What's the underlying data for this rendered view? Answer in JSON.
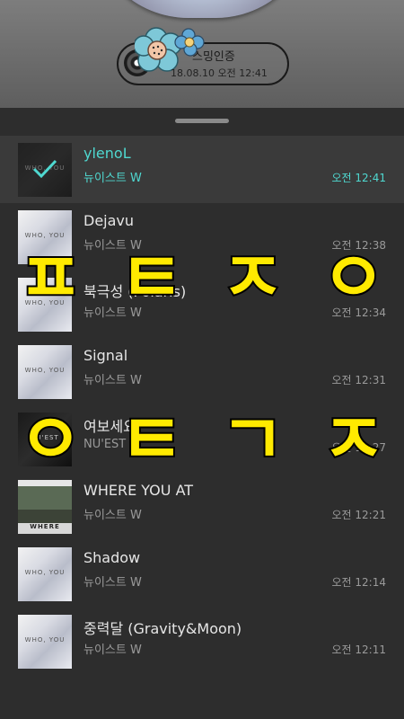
{
  "certification": {
    "label": "스밍인증",
    "datetime": "18.08.10 오전 12:41"
  },
  "songs": [
    {
      "title": "ylenoL",
      "artist": "뉴이스트 W",
      "time": "오전 12:41",
      "selected": true
    },
    {
      "title": "Dejavu",
      "artist": "뉴이스트 W",
      "time": "오전 12:38"
    },
    {
      "title": "북극성 (Polaris)",
      "artist": "뉴이스트 W",
      "time": "오전 12:34"
    },
    {
      "title": "Signal",
      "artist": "뉴이스트 W",
      "time": "오전 12:31"
    },
    {
      "title": "여보세요",
      "artist": "NU'EST",
      "time": "오전 12:27"
    },
    {
      "title": "WHERE YOU AT",
      "artist": "뉴이스트 W",
      "time": "오전 12:21"
    },
    {
      "title": "Shadow",
      "artist": "뉴이스트 W",
      "time": "오전 12:14"
    },
    {
      "title": "중력달 (Gravity&Moon)",
      "artist": "뉴이스트 W",
      "time": "오전 12:11"
    }
  ],
  "album_art": {
    "wh_label": "WHO, YOU",
    "hello_label": "NU'EST",
    "where_label": "WHERE"
  },
  "overlay_text": {
    "line1": [
      "ㅍ",
      "ㅌ",
      "ㅈ",
      "ㅇ"
    ],
    "line2": [
      "ㅇ",
      "ㅌ",
      "ㄱ",
      "ㅈ"
    ]
  },
  "colors": {
    "highlight": "#4fd8d0",
    "overlay_fill": "#ffea00"
  }
}
